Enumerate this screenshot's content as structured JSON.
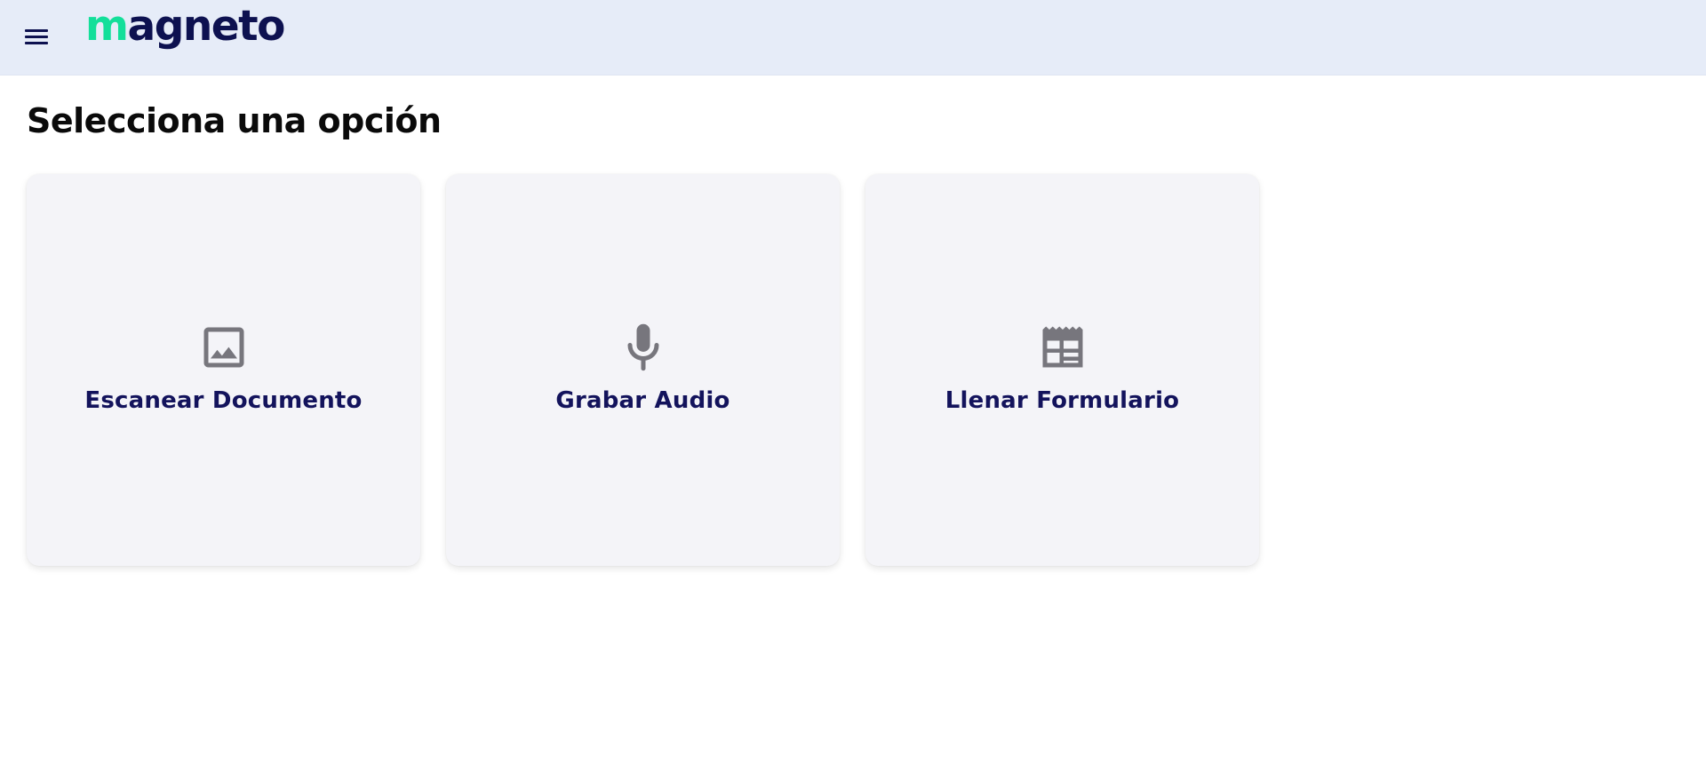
{
  "header": {
    "logo": {
      "first_letter": "m",
      "rest": "agneto"
    },
    "menu_icon": "hamburger-menu-icon"
  },
  "colors": {
    "header_bg": "#e6ecf8",
    "logo_accent": "#13df9a",
    "brand_navy": "#0d1150",
    "card_bg": "#f4f4f8",
    "icon_gray": "#77767d"
  },
  "page": {
    "title": "Selecciona una opción"
  },
  "options": [
    {
      "label": "Escanear Documento",
      "icon": "image-icon"
    },
    {
      "label": "Grabar Audio",
      "icon": "microphone-icon"
    },
    {
      "label": "Llenar Formulario",
      "icon": "form-icon"
    }
  ]
}
